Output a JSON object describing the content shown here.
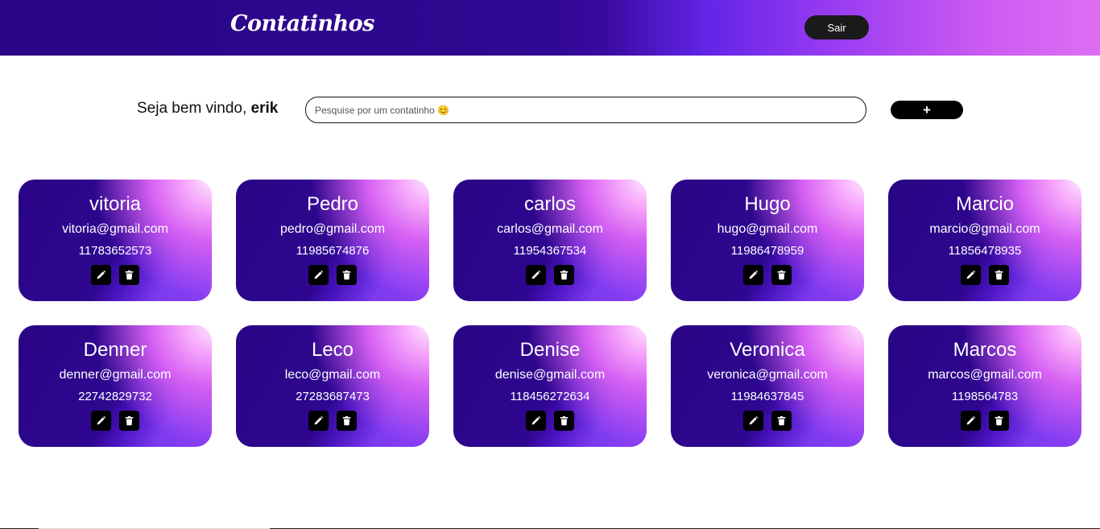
{
  "header": {
    "logo": "Contatinhos",
    "logout_label": "Sair"
  },
  "welcome": {
    "prefix": "Seja bem vindo,",
    "username": "erik"
  },
  "search": {
    "placeholder": "Pesquise por um contatinho 😊"
  },
  "add_button": {
    "icon": "plus-icon",
    "label": "+"
  },
  "contacts": [
    {
      "name": "vitoria",
      "email": "vitoria@gmail.com",
      "phone": "11783652573"
    },
    {
      "name": "Pedro",
      "email": "pedro@gmail.com",
      "phone": "11985674876"
    },
    {
      "name": "carlos",
      "email": "carlos@gmail.com",
      "phone": "11954367534"
    },
    {
      "name": "Hugo",
      "email": "hugo@gmail.com",
      "phone": "11986478959"
    },
    {
      "name": "Marcio",
      "email": "marcio@gmail.com",
      "phone": "11856478935"
    },
    {
      "name": "Denner",
      "email": "denner@gmail.com",
      "phone": "22742829732"
    },
    {
      "name": "Leco",
      "email": "leco@gmail.com",
      "phone": "27283687473"
    },
    {
      "name": "Denise",
      "email": "denise@gmail.com",
      "phone": "118456272634"
    },
    {
      "name": "Veronica",
      "email": "veronica@gmail.com",
      "phone": "11984637845"
    },
    {
      "name": "Marcos",
      "email": "marcos@gmail.com",
      "phone": "1198564783"
    }
  ],
  "card_actions": {
    "edit_icon": "pencil-icon",
    "delete_icon": "trash-icon"
  },
  "colors": {
    "header_dark": "#2a0585",
    "header_light": "#de6ef4",
    "card_base": "#2e0690",
    "button_dark": "#000000"
  }
}
